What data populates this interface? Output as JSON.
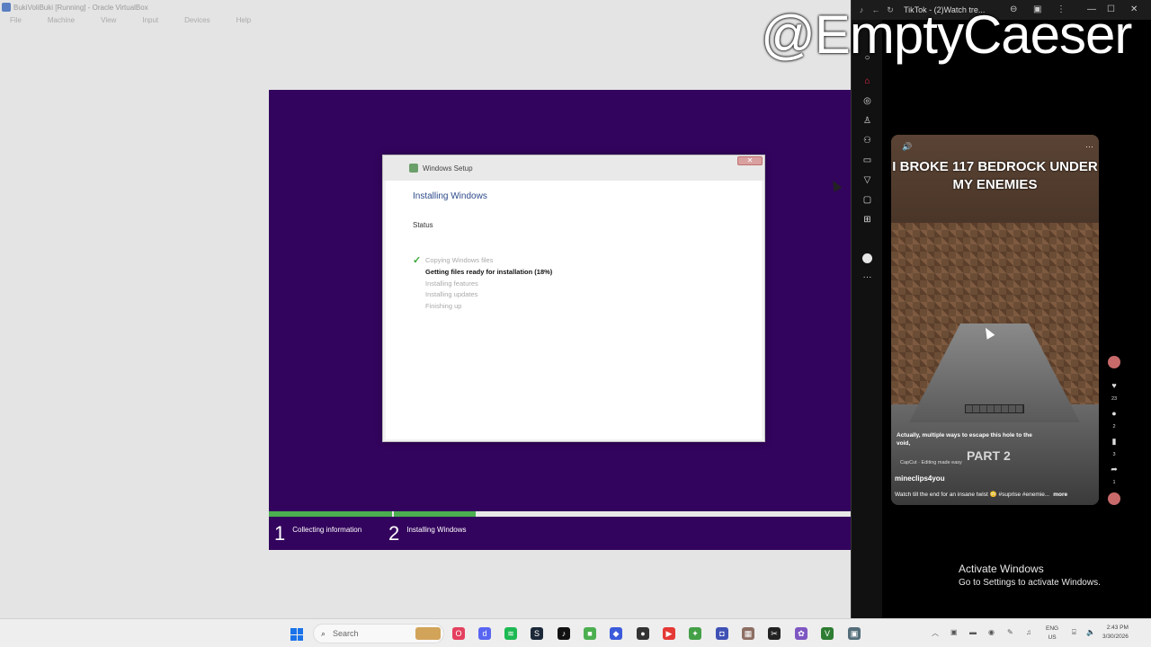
{
  "vbox": {
    "title": "BukiVoliBuki [Running] - Oracle VirtualBox",
    "menu": [
      "File",
      "Machine",
      "View",
      "Input",
      "Devices",
      "Help"
    ]
  },
  "setup": {
    "window_title": "Windows Setup",
    "close_label": "✕",
    "heading": "Installing Windows",
    "status_label": "Status",
    "tasks": [
      {
        "label": "Copying Windows files",
        "state": "done"
      },
      {
        "label": "Getting files ready for installation (18%)",
        "state": "active"
      },
      {
        "label": "Installing features",
        "state": "pending"
      },
      {
        "label": "Installing updates",
        "state": "pending"
      },
      {
        "label": "Finishing up",
        "state": "pending"
      }
    ],
    "progress": {
      "collecting_fraction": 1.0,
      "installing_fraction": 0.18
    },
    "steps": [
      {
        "num": "1",
        "label": "Collecting information"
      },
      {
        "num": "2",
        "label": "Installing Windows"
      }
    ],
    "bg_color": "#33045e",
    "progress_color": "#4caf50"
  },
  "tiktok": {
    "tab_title": "TikTok - (2)Watch tre...",
    "sidebar_icons": [
      "search-icon",
      "home-icon",
      "explore-icon",
      "following-icon",
      "friends-icon",
      "live-icon",
      "activity-icon",
      "messages-icon",
      "upload-icon",
      "profile-icon",
      "more-icon"
    ],
    "watermark": "@EmptyCaeser",
    "video": {
      "headline": "I BROKE 117 BEDROCK UNDER MY ENEMIES",
      "caption": "Actually, multiple ways to escape this hole to the void,",
      "capcut": "CapCut · Editing made easy",
      "part_label": "PART 2",
      "author": "mineclips4you",
      "description": "Watch till the end for an insane twist 😳 #suprise #enemie...",
      "more_label": "more"
    },
    "counts": {
      "likes": "23",
      "comments": "2",
      "saves": "3",
      "shares": "1"
    }
  },
  "activation": {
    "line1": "Activate Windows",
    "line2": "Go to Settings to activate Windows."
  },
  "taskbar": {
    "search_placeholder": "Search",
    "lang_line1": "ENG",
    "lang_line2": "US",
    "time": "2:43 PM",
    "date": "3/30/2026"
  }
}
